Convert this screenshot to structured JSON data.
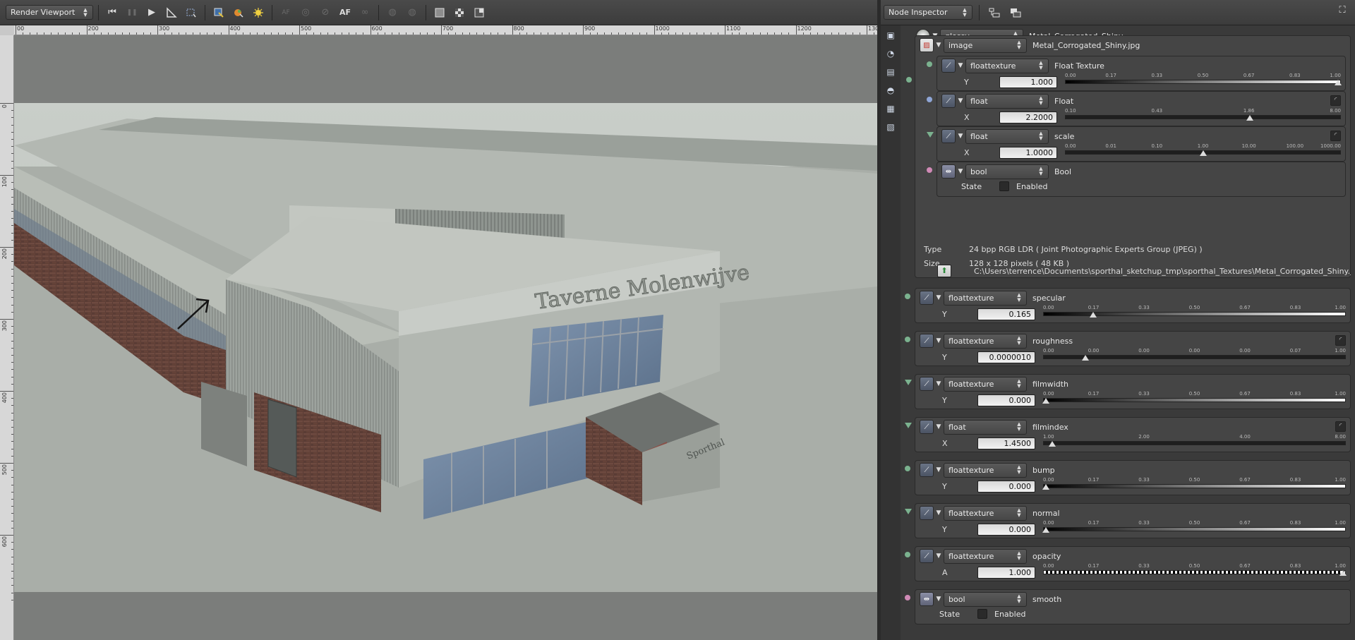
{
  "viewport": {
    "mode_combo": "Render Viewport",
    "toolbar": {
      "rewind": "⏮",
      "pause": "❚❚",
      "play": "▶",
      "af_label": "AF",
      "maximize": "⛶"
    },
    "ruler_top": [
      "00",
      "200",
      "300",
      "400",
      "500",
      "600",
      "700",
      "800",
      "900",
      "1000",
      "1100",
      "1200",
      "1300"
    ],
    "ruler_left": [
      "0",
      "100",
      "200",
      "300",
      "400",
      "500",
      "600"
    ],
    "render": {
      "sign_text": "Taverne Molenwijve",
      "awning_text": "Sporthal"
    }
  },
  "inspector": {
    "title_combo": "Node Inspector",
    "maximize": "⛶",
    "root": {
      "type": "glossy",
      "name": "Metal_Corrogated_Shiny"
    },
    "image_node": {
      "type": "image",
      "name": "Metal_Corrogated_Shiny.jpg",
      "info": {
        "type_label": "Type",
        "type_value": "24 bpp RGB LDR ( Joint Photographic Experts Group (JPEG) )",
        "size_label": "Size",
        "size_value": "128 x 128 pixels ( 48 KB )",
        "path": "C:\\Users\\terrence\\Documents\\sporthal_sketchup_tmp\\sporthal_Textures\\Metal_Corrogated_Shiny.jpg"
      },
      "children": [
        {
          "type": "floattexture",
          "name": "Float Texture",
          "axis": "Y",
          "value": "1.000",
          "ticks": [
            "0.00",
            "0.17",
            "0.33",
            "0.50",
            "0.67",
            "0.83",
            "1.00"
          ],
          "track": "grad",
          "handle": 1.0,
          "pin": "green",
          "curve": false
        },
        {
          "type": "float",
          "name": "Float",
          "axis": "X",
          "value": "2.2000",
          "ticks": [
            "0.10",
            "0.43",
            "1.86",
            "8.00"
          ],
          "track": "dark",
          "handle": 0.67,
          "pin": "blue",
          "curve": true
        },
        {
          "type": "float",
          "name": "scale",
          "axis": "X",
          "value": "1.0000",
          "ticks": [
            "0.00",
            "0.01",
            "0.10",
            "1.00",
            "10.00",
            "100.00",
            "1000.00"
          ],
          "track": "dark",
          "handle": 0.5,
          "pin": "tri",
          "curve": true
        },
        {
          "type": "bool",
          "name": "Bool",
          "state_label": "State",
          "check_label": "Enabled",
          "pin": "pink"
        }
      ]
    },
    "params": [
      {
        "type": "floattexture",
        "name": "specular",
        "axis": "Y",
        "value": "0.165",
        "ticks": [
          "0.00",
          "0.17",
          "0.33",
          "0.50",
          "0.67",
          "0.83",
          "1.00"
        ],
        "track": "grad",
        "handle": 0.165,
        "pin": "green",
        "curve": false
      },
      {
        "type": "floattexture",
        "name": "roughness",
        "axis": "Y",
        "value": "0.0000010",
        "ticks": [
          "0.00",
          "0.00",
          "0.00",
          "0.00",
          "0.00",
          "0.07",
          "1.00"
        ],
        "track": "dark",
        "handle": 0.14,
        "pin": "green",
        "curve": true
      },
      {
        "type": "floattexture",
        "name": "filmwidth",
        "axis": "Y",
        "value": "0.000",
        "ticks": [
          "0.00",
          "0.17",
          "0.33",
          "0.50",
          "0.67",
          "0.83",
          "1.00"
        ],
        "track": "grad",
        "handle": 0.0,
        "pin": "tri",
        "curve": false
      },
      {
        "type": "float",
        "name": "filmindex",
        "axis": "X",
        "value": "1.4500",
        "ticks": [
          "1.00",
          "2.00",
          "4.00",
          "8.00"
        ],
        "track": "dark",
        "handle": 0.03,
        "pin": "tri",
        "curve": true
      },
      {
        "type": "floattexture",
        "name": "bump",
        "axis": "Y",
        "value": "0.000",
        "ticks": [
          "0.00",
          "0.17",
          "0.33",
          "0.50",
          "0.67",
          "0.83",
          "1.00"
        ],
        "track": "grad",
        "handle": 0.0,
        "pin": "green",
        "curve": false
      },
      {
        "type": "floattexture",
        "name": "normal",
        "axis": "Y",
        "value": "0.000",
        "ticks": [
          "0.00",
          "0.17",
          "0.33",
          "0.50",
          "0.67",
          "0.83",
          "1.00"
        ],
        "track": "grad",
        "handle": 0.0,
        "pin": "tri",
        "curve": false
      },
      {
        "type": "floattexture",
        "name": "opacity",
        "axis": "A",
        "value": "1.000",
        "ticks": [
          "0.00",
          "0.17",
          "0.33",
          "0.50",
          "0.67",
          "0.83",
          "1.00"
        ],
        "track": "checker",
        "handle": 1.0,
        "pin": "green",
        "curve": false
      },
      {
        "type": "bool",
        "name": "smooth",
        "state_label": "State",
        "check_label": "Enabled",
        "pin": "pink"
      }
    ]
  },
  "colors": {
    "panel": "#3a3a3a",
    "node": "#454545",
    "pin_green": "#7bb28f",
    "pin_blue": "#8fa6d6",
    "pin_pink": "#d08ab6"
  }
}
